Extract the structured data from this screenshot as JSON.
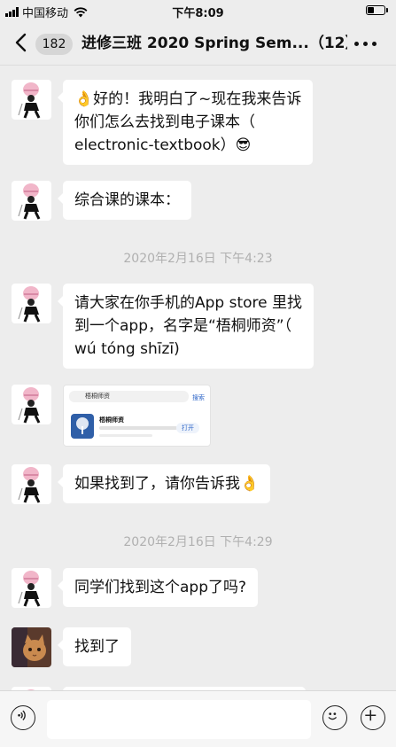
{
  "status_bar": {
    "carrier": "中国移动",
    "time": "下午8:09"
  },
  "nav": {
    "unread_count": "182",
    "title": "进修三班 2020 Spring Sem...（12）"
  },
  "messages": [
    {
      "lines": [
        "👌好的！我明白了~现在我来告诉",
        "你们怎么去找到电子课本（",
        "electronic-textbook）😎"
      ]
    },
    {
      "lines": [
        "综合课的课本："
      ]
    },
    {
      "lines": [
        "请大家在你手机的App store 里找",
        "到一个app，名字是“梧桐师资”（",
        "wú tóng  shīzī)"
      ]
    },
    {
      "lines": [
        "如果找到了，请你告诉我👌"
      ]
    },
    {
      "lines": [
        "同学们找到这个app了吗?"
      ]
    },
    {
      "lines": [
        "找到了"
      ]
    }
  ],
  "timestamps": [
    "2020年2月16日 下午4:23",
    "2020年2月16日 下午4:29"
  ],
  "shared_image": {
    "search_text": "梧桐师资",
    "search_button": "搜索",
    "app_name": "梧桐师资",
    "open_button": "打开"
  },
  "icons": {
    "back": "chevron-left-icon",
    "more": "more-dots-icon",
    "voice": "voice-icon",
    "emoji": "emoji-icon",
    "add": "plus-icon"
  },
  "colors": {
    "background": "#ededed",
    "bubble": "#ffffff",
    "timestamp": "#b0b0b0"
  }
}
